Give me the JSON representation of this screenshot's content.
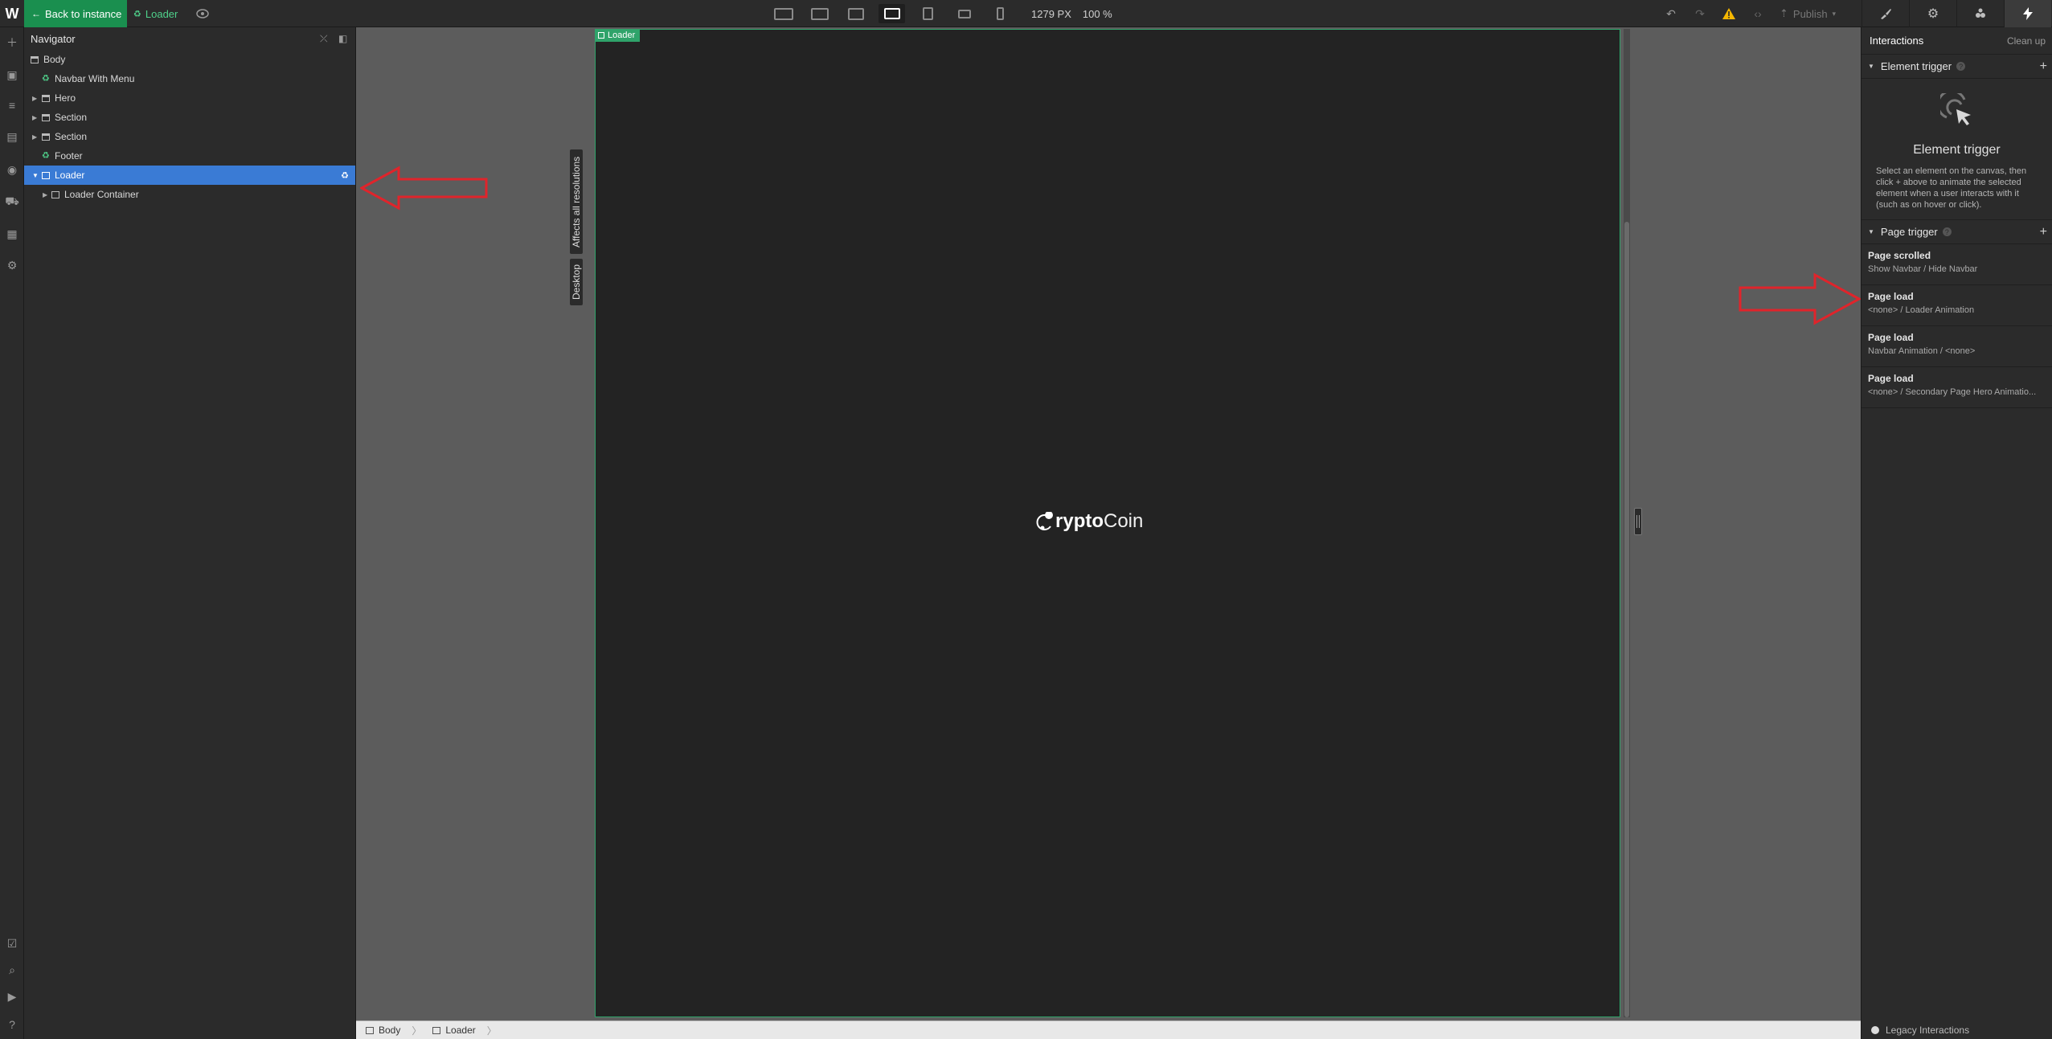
{
  "topbar": {
    "logo": "W",
    "back_label": "Back to instance",
    "component_name": "Loader",
    "width_readout": "1279 PX",
    "zoom_readout": "100 %",
    "publish_label": "Publish"
  },
  "navigator": {
    "title": "Navigator",
    "items": [
      {
        "label": "Body"
      },
      {
        "label": "Navbar With Menu"
      },
      {
        "label": "Hero"
      },
      {
        "label": "Section"
      },
      {
        "label": "Section"
      },
      {
        "label": "Footer"
      },
      {
        "label": "Loader"
      },
      {
        "label": "Loader Container"
      }
    ]
  },
  "canvas": {
    "frame_label": "Loader",
    "side_tab_affects": "Affects all resolutions",
    "side_tab_desktop": "Desktop",
    "brand_bold": "rypto",
    "brand_light": "Coin"
  },
  "breadcrumb": [
    "Body",
    "Loader"
  ],
  "interactions": {
    "title": "Interactions",
    "clean_up": "Clean up",
    "element_trigger": {
      "heading": "Element trigger",
      "title": "Element trigger",
      "description": "Select an element on the canvas, then click + above to animate the selected element when a user interacts with it (such as on hover or click)."
    },
    "page_trigger": {
      "heading": "Page trigger",
      "items": [
        {
          "title": "Page scrolled",
          "subtitle": "Show Navbar / Hide Navbar"
        },
        {
          "title": "Page load",
          "subtitle": "<none> / Loader Animation"
        },
        {
          "title": "Page load",
          "subtitle": "Navbar Animation / <none>"
        },
        {
          "title": "Page load",
          "subtitle": "<none> / Secondary Page Hero Animatio..."
        }
      ]
    },
    "legacy_label": "Legacy Interactions"
  },
  "colors": {
    "accent_green": "#1a8f4f",
    "selection_blue": "#3a7bd5",
    "annotation_red": "#e0242b"
  }
}
